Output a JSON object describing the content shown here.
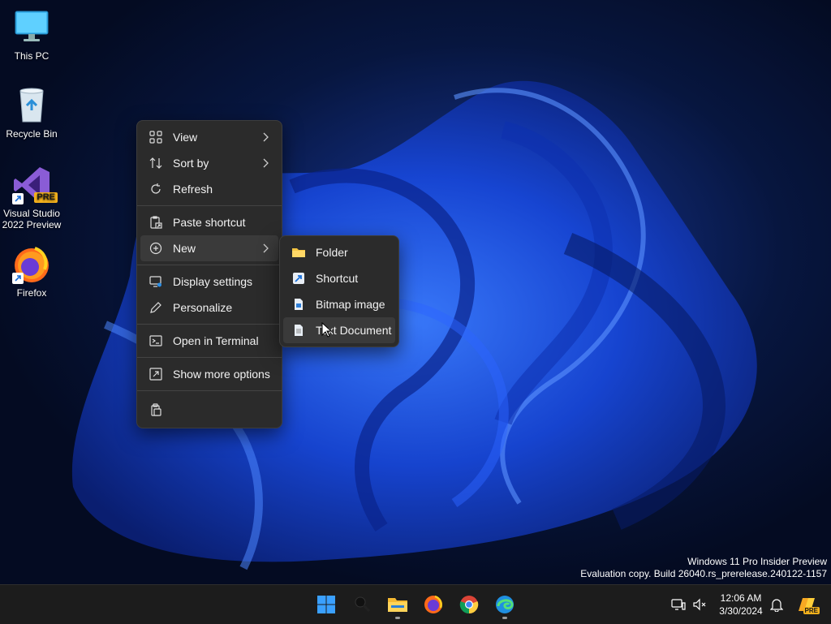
{
  "desktop_icons": [
    {
      "label": "This PC",
      "icon": "monitor-icon"
    },
    {
      "label": "Recycle Bin",
      "icon": "recycle-bin-icon"
    },
    {
      "label": "Visual Studio 2022 Preview",
      "icon": "visual-studio-icon",
      "badge": "PRE"
    },
    {
      "label": "Firefox",
      "icon": "firefox-icon"
    }
  ],
  "context_menu": {
    "items": [
      {
        "label": "View",
        "icon": "grid-icon",
        "has_submenu": true
      },
      {
        "label": "Sort by",
        "icon": "sort-icon",
        "has_submenu": true
      },
      {
        "label": "Refresh",
        "icon": "refresh-icon",
        "has_submenu": false
      },
      {
        "label": "Paste shortcut",
        "icon": "paste-shortcut-icon",
        "has_submenu": false
      },
      {
        "label": "New",
        "icon": "plus-circle-icon",
        "has_submenu": true
      },
      {
        "label": "Display settings",
        "icon": "display-settings-icon",
        "has_submenu": false
      },
      {
        "label": "Personalize",
        "icon": "pen-icon",
        "has_submenu": false
      },
      {
        "label": "Open in Terminal",
        "icon": "terminal-icon",
        "has_submenu": false
      },
      {
        "label": "Show more options",
        "icon": "more-options-icon",
        "has_submenu": false
      }
    ],
    "bottom_icon": "clipboard-icon"
  },
  "new_submenu": {
    "items": [
      {
        "label": "Folder",
        "icon": "folder-icon"
      },
      {
        "label": "Shortcut",
        "icon": "shortcut-icon"
      },
      {
        "label": "Bitmap image",
        "icon": "bitmap-icon"
      },
      {
        "label": "Text Document",
        "icon": "text-document-icon"
      }
    ]
  },
  "watermark": {
    "line1": "Windows 11 Pro Insider Preview",
    "line2": "Evaluation copy. Build 26040.rs_prerelease.240122-1157"
  },
  "taskbar": {
    "apps": [
      "start-icon",
      "search-icon",
      "file-explorer-icon",
      "firefox-icon",
      "chrome-icon",
      "edge-icon"
    ],
    "clock_time": "12:06 AM",
    "clock_date": "3/30/2024",
    "tray_icons": [
      "network-icon",
      "volume-muted-icon",
      "notification-bell-icon",
      "copilot-icon"
    ],
    "copilot_badge": "PRE"
  },
  "colors": {
    "menu_bg": "#2b2b2b",
    "hover": "#3a3a3a",
    "taskbar_bg": "#1c1c1c",
    "accent": "#0078d4"
  }
}
